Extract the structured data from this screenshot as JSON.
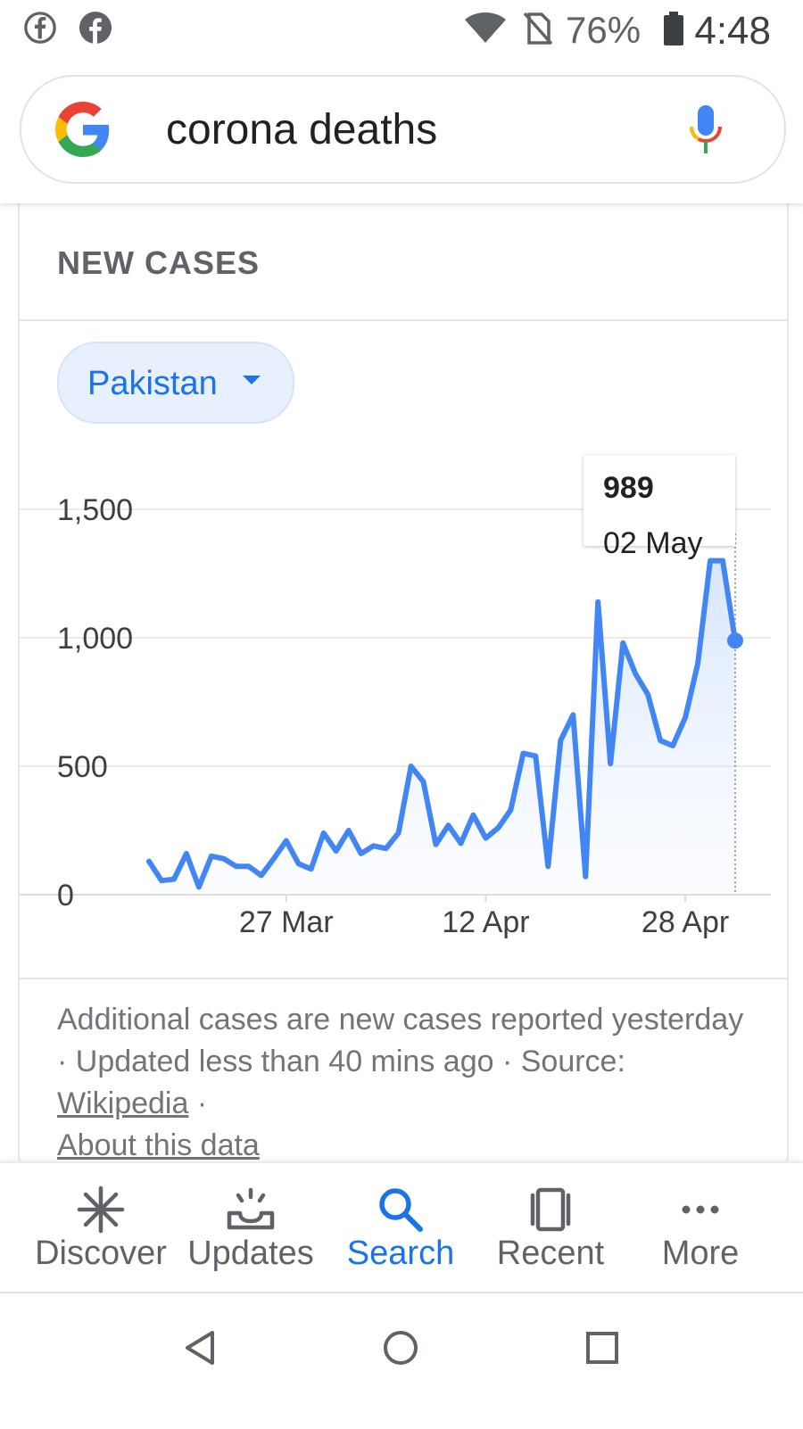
{
  "status_bar": {
    "battery_percent": "76%",
    "time": "4:48",
    "icons": [
      "facebook-icon",
      "facebook-icon",
      "wifi-icon",
      "no-sim-icon",
      "battery-icon"
    ]
  },
  "search": {
    "query": "corona deaths",
    "icons": [
      "google-logo-icon",
      "microphone-icon"
    ]
  },
  "card": {
    "title": "NEW CASES",
    "region_selector": "Pakistan",
    "tooltip": {
      "value": "989",
      "date": "02 May"
    },
    "footnote": {
      "text1": "Additional cases are new cases reported yesterday · Updated less than 40 mins ago  ·  Source: ",
      "source_link": "Wikipedia",
      "sep": " · ",
      "about_link": "About this data"
    }
  },
  "chart_data": {
    "type": "area",
    "title": "NEW CASES",
    "xlabel": "",
    "ylabel": "",
    "y_ticks": [
      "0",
      "500",
      "1,000",
      "1,500"
    ],
    "x_ticks": [
      "27 Mar",
      "12 Apr",
      "28 Apr"
    ],
    "ylim": [
      0,
      1500
    ],
    "grid": true,
    "colors": {
      "line": "#4285f4",
      "fill": "#e8f0fe",
      "grid": "#ebebeb"
    },
    "series": [
      {
        "values": [
          130,
          55,
          60,
          160,
          30,
          150,
          140,
          110,
          110,
          75,
          140,
          210,
          120,
          100,
          240,
          170,
          250,
          160,
          190,
          180,
          240,
          500,
          440,
          195,
          270,
          200,
          310,
          220,
          260,
          330,
          550,
          540,
          110,
          600,
          700,
          70,
          1140,
          510,
          980,
          860,
          780,
          600,
          580,
          690,
          900,
          1300,
          1300,
          989
        ]
      }
    ],
    "highlight": {
      "index": 47,
      "value": 989,
      "date": "02 May"
    }
  },
  "bottom_nav": {
    "items": [
      {
        "label": "Discover",
        "icon": "asterisk-icon",
        "active": false
      },
      {
        "label": "Updates",
        "icon": "inbox-tray-icon",
        "active": false
      },
      {
        "label": "Search",
        "icon": "search-icon",
        "active": true
      },
      {
        "label": "Recent",
        "icon": "recent-cards-icon",
        "active": false
      },
      {
        "label": "More",
        "icon": "more-dots-icon",
        "active": false
      }
    ]
  },
  "system_nav": {
    "icons": [
      "back-triangle-icon",
      "home-circle-icon",
      "overview-square-icon"
    ]
  }
}
